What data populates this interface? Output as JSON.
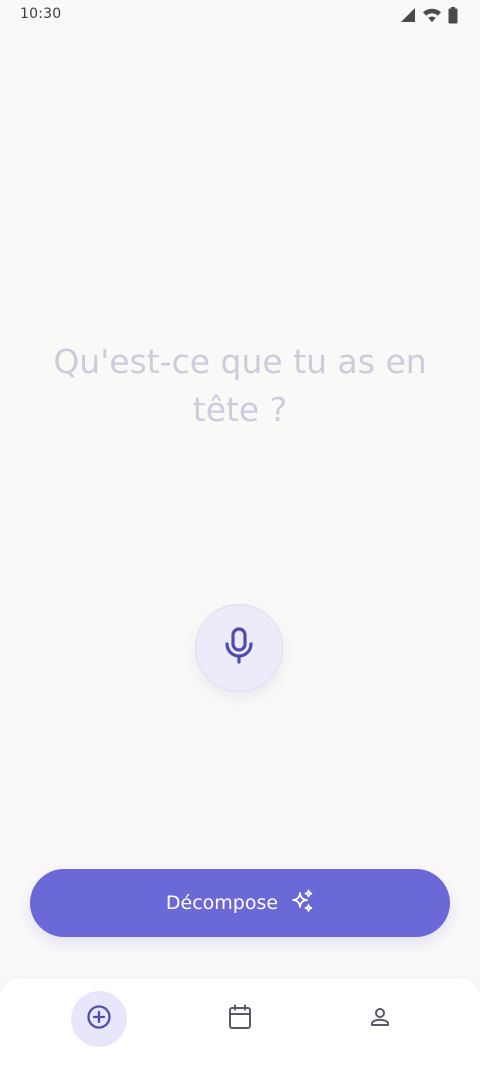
{
  "status_bar": {
    "time": "10:30",
    "icons": [
      "cellular-signal-icon",
      "wifi-icon",
      "battery-icon"
    ]
  },
  "main": {
    "prompt": "Qu'est-ce que tu as en tête ?",
    "mic_icon": "microphone-icon"
  },
  "action": {
    "decompose_label": "Décompose",
    "decompose_icon": "sparkles-icon"
  },
  "bottom_nav": {
    "items": [
      {
        "icon": "add-circle-icon",
        "active": true
      },
      {
        "icon": "calendar-icon",
        "active": false
      },
      {
        "icon": "profile-icon",
        "active": false
      }
    ]
  },
  "colors": {
    "background": "#FBF9F8",
    "accent": "#6B69D8",
    "accent_light": "#EDEBF9",
    "icon_accent": "#4F4DB0",
    "prompt_text": "#CECCDC",
    "nav_icon": "#5A5A66"
  }
}
